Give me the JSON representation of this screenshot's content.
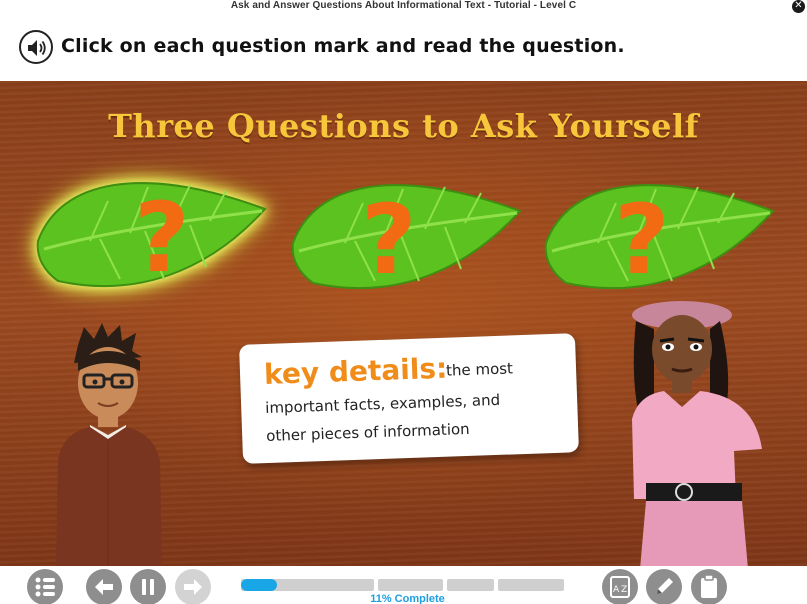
{
  "window": {
    "title": "Ask and Answer Questions About Informational Text - Tutorial - Level C",
    "close_glyph": "✕"
  },
  "instruction": {
    "text": "Click on each question mark and read the question.",
    "audio_icon": "speaker-icon"
  },
  "stage": {
    "title": "Three Questions to Ask Yourself",
    "leaves": [
      {
        "symbol": "?",
        "highlighted": true
      },
      {
        "symbol": "?",
        "highlighted": false
      },
      {
        "symbol": "?",
        "highlighted": false
      }
    ],
    "card": {
      "term": "key details:",
      "definition_line1": "the most",
      "definition_line2": "important facts, examples, and",
      "definition_line3": "other pieces of information"
    },
    "colors": {
      "title": "#f7c63a",
      "term": "#f08c1a",
      "question_mark": "#f26a12",
      "leaf": "#5cc21f",
      "background": "#8a3f1a"
    }
  },
  "controls": {
    "menu_icon": "list-icon",
    "back_icon": "arrow-left-icon",
    "pause_icon": "pause-icon",
    "forward_icon": "arrow-right-icon",
    "glossary_icon": "glossary-az-icon",
    "notes_icon": "pencil-icon",
    "clipboard_icon": "clipboard-icon",
    "progress_fraction": 0.11,
    "progress_label": "11% Complete",
    "progress_color": "#19a6e6"
  }
}
